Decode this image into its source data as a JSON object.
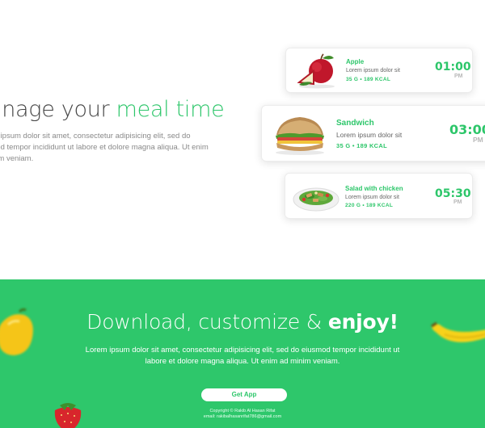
{
  "hero": {
    "headline_main": "anage your ",
    "headline_accent": "meal time",
    "intro_line1": "m ipsum dolor sit amet, consectetur adipisicing elit, sed do",
    "intro_line2": "nod tempor incididunt ut labore et dolore magna aliqua. Ut enim",
    "intro_line3": "nim veniam."
  },
  "meals": [
    {
      "name": "Apple",
      "desc": "Lorem ipsum dolor sit",
      "meta": "35 G  •  189 KCAL",
      "time": "01:00",
      "ampm": "PM",
      "icon": "apple-icon"
    },
    {
      "name": "Sandwich",
      "desc": "Lorem ipsum dolor sit",
      "meta": "35 G  •  189 KCAL",
      "time": "03:00",
      "ampm": "PM",
      "icon": "sandwich-icon"
    },
    {
      "name": "Salad with chicken",
      "desc": "Lorem ipsum dolor sit",
      "meta": "220 G  •  189 KCAL",
      "time": "05:30",
      "ampm": "PM",
      "icon": "salad-icon"
    }
  ],
  "promo": {
    "title_light": "Download, customize & ",
    "title_bold": "enjoy!",
    "text_line1": "Lorem ipsum dolor sit amet, consectetur adipisicing elit, sed do eiusmod tempor incididunt ut",
    "text_line2": "labore et dolore magna aliqua. Ut enim ad minim veniam.",
    "button_label": "Get App",
    "copyright": "Copyright © Rakib Al Hasan Rifat",
    "email": "email: rakibalhasanrifat786@gmail.com"
  },
  "colors": {
    "accent": "#2dc66a",
    "promo_bg": "#2ec76b"
  },
  "decorations": [
    "pepper-icon",
    "banana-icon",
    "strawberry-icon"
  ]
}
